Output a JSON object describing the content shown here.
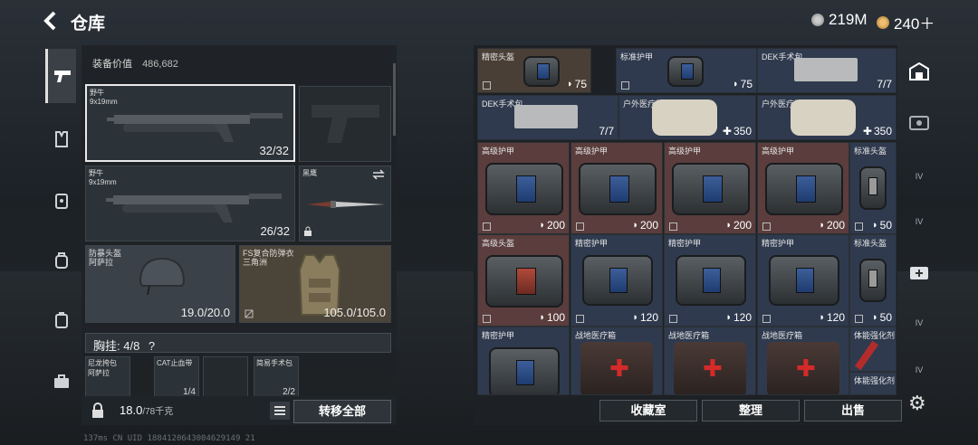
{
  "header": {
    "title": "仓库",
    "silver": "219M",
    "gold": "240＋"
  },
  "left": {
    "equip_value_label": "装备价值",
    "equip_value": "486,682",
    "primary": {
      "name": "野牛",
      "caliber": "9x19mm",
      "ammo": "32/32"
    },
    "secondary": {
      "name": "野牛",
      "caliber": "9x19mm",
      "ammo": "26/32"
    },
    "melee": {
      "name": "黑鹰"
    },
    "helmet": {
      "name": "防暴头盔",
      "sub": "阿萨拉",
      "durability": "19.0/20.0"
    },
    "armor": {
      "name": "FS复合防弹衣",
      "sub": "三角洲",
      "durability": "105.0/105.0"
    },
    "chest_label": "胸挂: 4/8",
    "chest_help": "?",
    "chest_items": [
      {
        "name": "尼龙挎包",
        "sub": "阿萨拉"
      },
      {
        "name": "CAT止血带",
        "count": "1/4"
      },
      {
        "name": ""
      },
      {
        "name": "简易手术包",
        "count": "2/2"
      }
    ],
    "weight": "18.0",
    "weight_max": "/78千克",
    "transfer_all": "转移全部"
  },
  "storage": {
    "items": [
      {
        "name": "精密头盔",
        "val": "75",
        "icon": "shield"
      },
      {
        "name": "标准护甲",
        "val": "75",
        "icon": "shield"
      },
      {
        "name": "DEK手术包",
        "val": "7/7",
        "icon": ""
      },
      {
        "name": "DEK手术包",
        "val": "7/7",
        "icon": ""
      },
      {
        "name": "户外医疗箱",
        "val": "350",
        "icon": "plus"
      },
      {
        "name": "户外医疗箱",
        "val": "350",
        "icon": "plus"
      },
      {
        "name": "高级护甲",
        "val": "200",
        "icon": "shield"
      },
      {
        "name": "高级护甲",
        "val": "200",
        "icon": "shield"
      },
      {
        "name": "高级护甲",
        "val": "200",
        "icon": "shield"
      },
      {
        "name": "高级护甲",
        "val": "200",
        "icon": "shield"
      },
      {
        "name": "标准头盔",
        "val": "50",
        "icon": "shield"
      },
      {
        "name": "高级头盔",
        "val": "100",
        "icon": "shield"
      },
      {
        "name": "精密护甲",
        "val": "120",
        "icon": "shield"
      },
      {
        "name": "精密护甲",
        "val": "120",
        "icon": "shield"
      },
      {
        "name": "精密护甲",
        "val": "120",
        "icon": "shield"
      },
      {
        "name": "标准头盔",
        "val": "50",
        "icon": "shield"
      },
      {
        "name": "精密护甲",
        "val": "",
        "icon": ""
      },
      {
        "name": "战地医疗箱",
        "val": "",
        "icon": ""
      },
      {
        "name": "战地医疗箱",
        "val": "",
        "icon": ""
      },
      {
        "name": "战地医疗箱",
        "val": "",
        "icon": ""
      },
      {
        "name": "体能强化剂",
        "val": "",
        "icon": ""
      },
      {
        "name": "体能强化剂",
        "val": "",
        "icon": ""
      }
    ],
    "btn_collection": "收藏室",
    "btn_sort": "整理",
    "btn_sell": "出售"
  },
  "right_bar": {
    "tags": [
      "IV",
      "IV",
      "IV",
      "IV"
    ]
  },
  "debug": "137ms  CN UID 1884120643004629149 21"
}
